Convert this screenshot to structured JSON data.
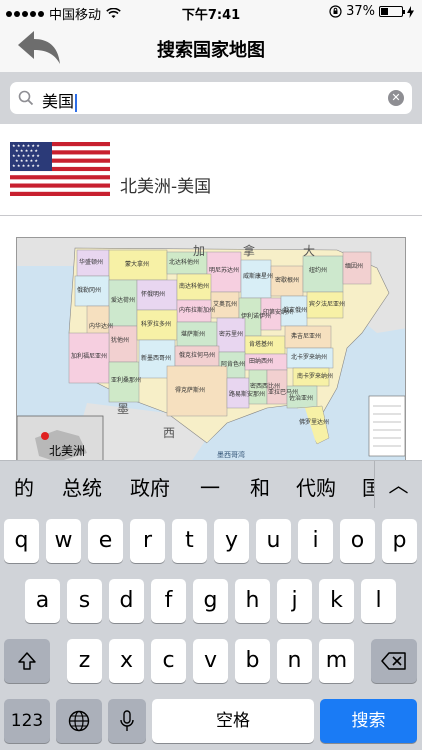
{
  "status": {
    "carrier": "中国移动",
    "time": "下午7:41",
    "battery": "37%",
    "battery_level": 0.37
  },
  "nav": {
    "title": "搜索国家地图",
    "back_icon": "back-arrow-icon"
  },
  "search": {
    "value": "美国"
  },
  "result": {
    "label": "北美洲-美国",
    "flag": "usa-flag"
  },
  "map": {
    "labels": {
      "canada": [
        "加",
        "拿",
        "大"
      ],
      "mexico": "墨",
      "west": "西",
      "inset_continent": "北美洲",
      "mexico_city": "墨西哥湾",
      "gulf": "墨西哥湾"
    },
    "states": [
      "华盛顿州",
      "蒙大拿州",
      "北达科他州",
      "明尼苏达州",
      "威斯康星州",
      "密歇根州",
      "纽约州",
      "缅因州",
      "俄勒冈州",
      "爱达荷州",
      "怀俄明州",
      "南达科他州",
      "艾奥瓦州",
      "伊利诺伊州",
      "印第安纳州",
      "俄亥俄州",
      "宾夕法尼亚州",
      "内布拉斯加州",
      "内华达州",
      "犹他州",
      "科罗拉多州",
      "堪萨斯州",
      "密苏里州",
      "肯塔基州",
      "弗吉尼亚州",
      "加利福尼亚州",
      "亚利桑那州",
      "新墨西哥州",
      "俄克拉何马州",
      "阿肯色州",
      "田纳西州",
      "北卡罗来纳州",
      "南卡罗来纳州",
      "得克萨斯州",
      "路易斯安那州",
      "密西西比州",
      "亚拉巴马州",
      "佐治亚州",
      "佛罗里达州"
    ]
  },
  "suggestions": [
    "的",
    "总统",
    "政府",
    "一",
    "和",
    "代购",
    "国"
  ],
  "keyboard": {
    "row1": [
      "q",
      "w",
      "e",
      "r",
      "t",
      "y",
      "u",
      "i",
      "o",
      "p"
    ],
    "row2": [
      "a",
      "s",
      "d",
      "f",
      "g",
      "h",
      "j",
      "k",
      "l"
    ],
    "row3": [
      "z",
      "x",
      "c",
      "v",
      "b",
      "n",
      "m"
    ],
    "num_label": "123",
    "space_label": "空格",
    "search_label": "搜索"
  }
}
